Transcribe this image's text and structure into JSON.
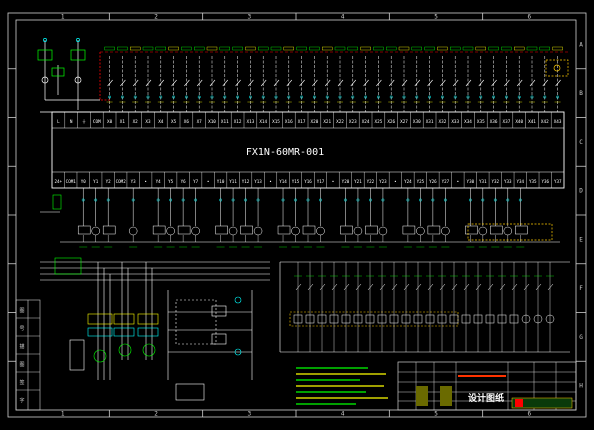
{
  "colors": {
    "background": "#000000",
    "frame": "#d0d0d0",
    "wire": "#ffffff",
    "terminal": "#00ffff",
    "label": "#00ff00",
    "label_alt": "#ffff00",
    "accent": "#ff0000",
    "highlight": "#ffcc00",
    "block_fill": "#6a6a00"
  },
  "grid": {
    "columns": [
      "1",
      "2",
      "3",
      "4",
      "5",
      "6"
    ],
    "rows": [
      "A",
      "B",
      "C",
      "D",
      "E",
      "F",
      "G",
      "H"
    ]
  },
  "plc": {
    "model": "FX1N-60MR-001",
    "input_terminals": [
      "L",
      "N",
      "⏚",
      "COM",
      "X0",
      "X1",
      "X2",
      "X3",
      "X4",
      "X5",
      "X6",
      "X7",
      "X10",
      "X11",
      "X12",
      "X13",
      "X14",
      "X15",
      "X16",
      "X17",
      "X20",
      "X21",
      "X22",
      "X23",
      "X24",
      "X25",
      "X26",
      "X27",
      "X30",
      "X31",
      "X32",
      "X33",
      "X34",
      "X35",
      "X36",
      "X37",
      "X40",
      "X41",
      "X42",
      "X43"
    ],
    "output_terminals": [
      "24+",
      "COM1",
      "Y0",
      "Y1",
      "Y2",
      "COM2",
      "Y3",
      "•",
      "Y4",
      "Y5",
      "Y6",
      "Y7",
      "•",
      "Y10",
      "Y11",
      "Y12",
      "Y13",
      "•",
      "Y14",
      "Y15",
      "Y16",
      "Y17",
      "•",
      "Y20",
      "Y21",
      "Y22",
      "Y23",
      "•",
      "Y24",
      "Y25",
      "Y26",
      "Y27",
      "•",
      "Y30",
      "Y31",
      "Y32",
      "Y33",
      "Y34",
      "Y35",
      "Y36",
      "Y37"
    ]
  },
  "title_block": {
    "title": "设计图纸"
  },
  "left_block_labels": [
    "图",
    "号",
    "描",
    "图",
    "签",
    "字"
  ]
}
